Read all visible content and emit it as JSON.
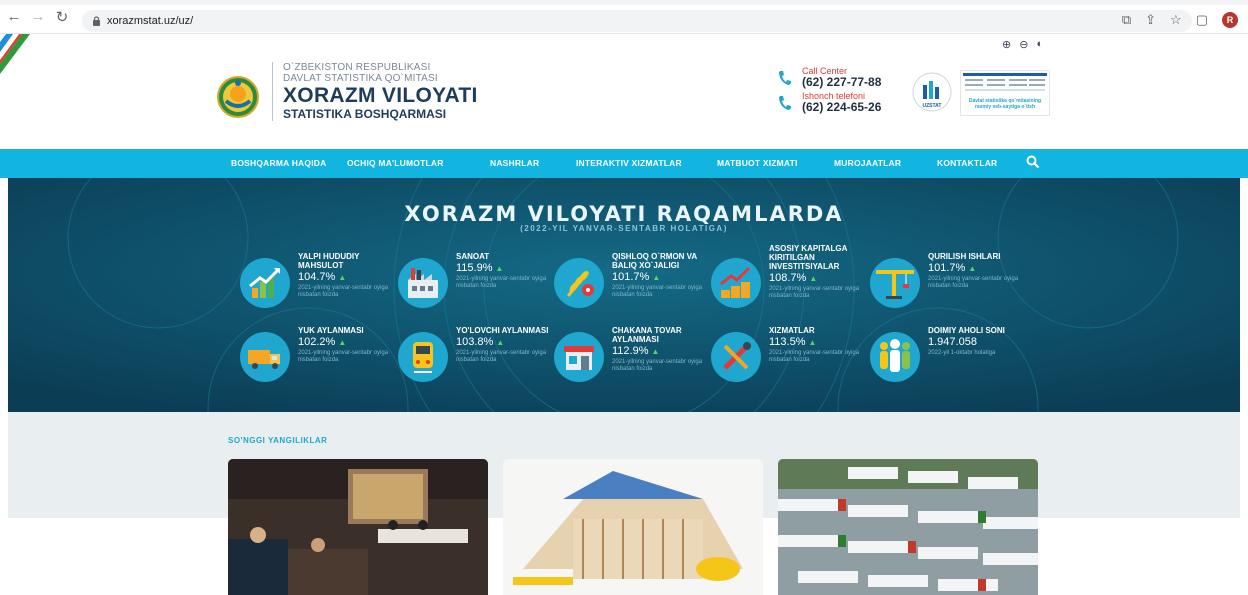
{
  "browser": {
    "url": "xorazmstat.uz/uz/",
    "profile_initial": "R"
  },
  "header": {
    "line1": "O`ZBEKISTON RESPUBLIKASI",
    "line2": "DAVLAT STATISTIKA QO`MITASI",
    "title": "XORAZM VILOYATI",
    "subtitle": "STATISTIKA BOSHQARMASI",
    "tools": [
      "⊕",
      "⊖",
      "◐"
    ],
    "call_center_label": "Call Center",
    "call_center_number": "(62) 227-77-88",
    "trust_label": "Ishonch telefoni",
    "trust_number": "(62) 224-65-26",
    "uzstat_label": "UZSTAT",
    "banner_text": "Davlat statistika qo`mitasining rasmiy veb-saytiga o`tish"
  },
  "menu": [
    "BOSHQARMA HAQIDA",
    "OCHIQ MA'LUMOTLAR",
    "NASHRLAR",
    "INTERAKTIV XIZMATLAR",
    "MATBUOT XIZMATI",
    "MUROJAATLAR",
    "KONTAKTLAR"
  ],
  "stats": {
    "title": "XORAZM VILOYATI RAQAMLARDA",
    "subtitle": "(2022-YIL YANVAR-SENTABR HOLATIGA)",
    "items": [
      {
        "name": "YALPI HUDUDIY MAHSULOT",
        "value": "104.7%",
        "note": "2021-yilning yanvar-sentabr oyiga nisbatan foizda",
        "icon": "growth-chart-icon"
      },
      {
        "name": "SANOAT",
        "value": "115.9%",
        "note": "2021-yilning yanvar-sentabr oyiga nisbatan foizda",
        "icon": "factory-icon"
      },
      {
        "name": "QISHLOQ O`RMON VA BALIQ XO`JALIGI",
        "value": "101.7%",
        "note": "2021-yilning yanvar-sentabr oyiga nisbatan foizda",
        "icon": "wheat-icon"
      },
      {
        "name": "ASOSIY KAPITALGA KIRITILGAN INVESTITSIYALAR",
        "value": "108.7%",
        "note": "2021-yilning yanvar-sentabr oyiga nisbatan foizda",
        "icon": "investment-icon"
      },
      {
        "name": "QURILISH ISHLARI",
        "value": "101.7%",
        "note": "2021-yilning yanvar-sentabr oyiga nisbatan foizda",
        "icon": "crane-icon"
      },
      {
        "name": "YUK AYLANMASI",
        "value": "102.2%",
        "note": "2021-yilning yanvar-sentabr oyiga nisbatan foizda",
        "icon": "truck-icon"
      },
      {
        "name": "YO'LOVCHI AYLANMASI",
        "value": "103.8%",
        "note": "2021-yilning yanvar-sentabr oyiga nisbatan foizda",
        "icon": "train-icon"
      },
      {
        "name": "CHAKANA TOVAR AYLANMASI",
        "value": "112.9%",
        "note": "2021-yilning yanvar-sentabr oyiga nisbatan foizda",
        "icon": "shop-icon"
      },
      {
        "name": "XIZMATLAR",
        "value": "113.5%",
        "note": "2021-yilning yanvar-sentabr oyiga nisbatan foizda",
        "icon": "tools-icon"
      },
      {
        "name": "DOIMIY AHOLI SONI",
        "value": "1.947.058",
        "note": "2022-yil 1-oktabr holatiga",
        "icon": "people-icon",
        "no_arrow": true
      }
    ]
  },
  "news": {
    "title": "SO'NGGI YANGILIKLAR"
  },
  "colors": {
    "menu": "#12b5e0",
    "stats_bg": "#0e4f6a",
    "accent": "#1fa7cf",
    "title": "#1f3c5a",
    "up_arrow": "#4cd964"
  }
}
